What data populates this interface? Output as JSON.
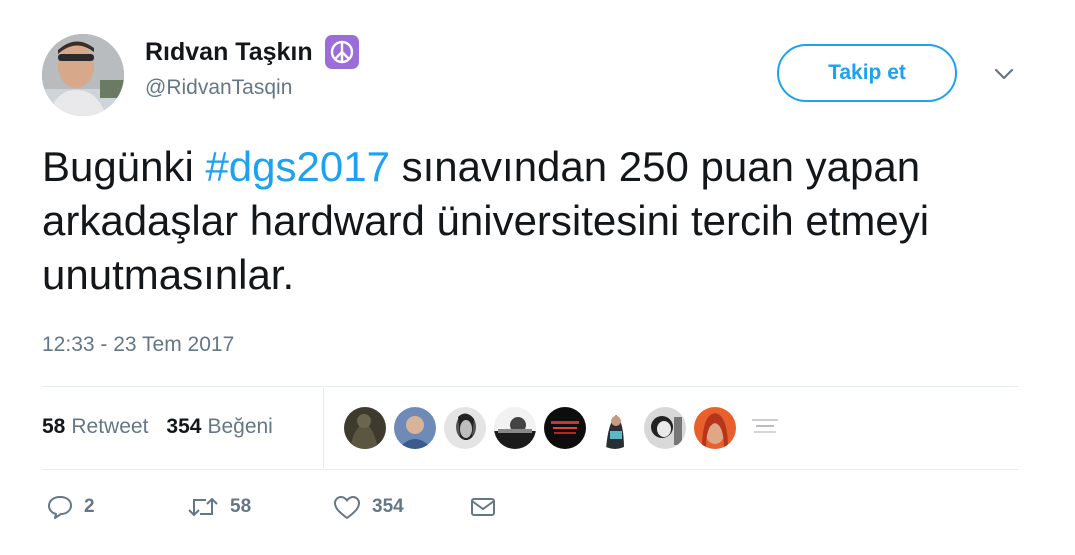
{
  "author": {
    "name": "Rıdvan Taşkın",
    "handle": "@RidvanTasqin",
    "badge_icon": "peace-sign-icon"
  },
  "follow_button": {
    "label": "Takip et"
  },
  "menu_icon": "chevron-down-icon",
  "tweet": {
    "text_before": "Bugünki ",
    "hashtag": "#dgs2017",
    "text_after": " sınavından 250 puan yapan arkadaşlar hardward üniversitesini tercih etmeyi unutmasınlar."
  },
  "timestamp": "12:33 - 23 Tem 2017",
  "stats": {
    "retweets": {
      "count": "58",
      "label": "Retweet"
    },
    "likes": {
      "count": "354",
      "label": "Beğeni"
    }
  },
  "liker_avatars": [
    {
      "icon": "user-avatar-1"
    },
    {
      "icon": "user-avatar-2"
    },
    {
      "icon": "user-avatar-3"
    },
    {
      "icon": "user-avatar-4"
    },
    {
      "icon": "user-avatar-5"
    },
    {
      "icon": "user-avatar-6"
    },
    {
      "icon": "user-avatar-7"
    },
    {
      "icon": "user-avatar-8"
    },
    {
      "icon": "user-avatar-9"
    }
  ],
  "actions": {
    "reply": {
      "icon": "reply-icon",
      "count": "2"
    },
    "retweet": {
      "icon": "retweet-icon",
      "count": "58"
    },
    "like": {
      "icon": "heart-icon",
      "count": "354"
    },
    "message": {
      "icon": "envelope-icon"
    }
  },
  "colors": {
    "accent": "#1da1f2",
    "secondary_text": "#657786",
    "primary_text": "#14171a",
    "badge": "#9b6dd8"
  }
}
